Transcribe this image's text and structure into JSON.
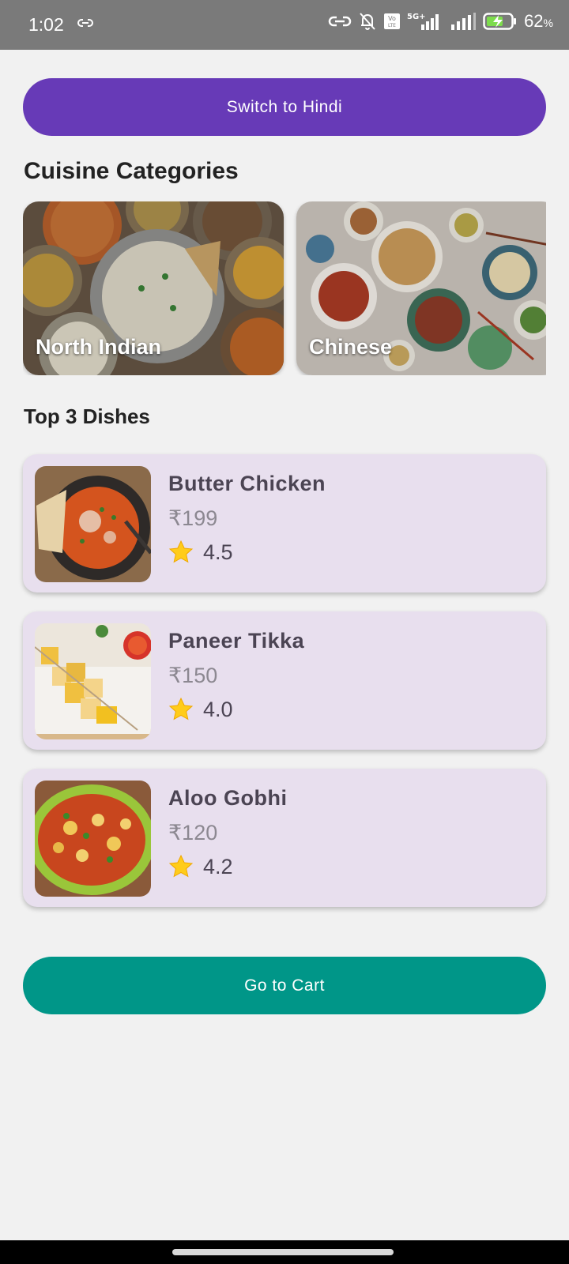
{
  "status_bar": {
    "time": "1:02",
    "battery_percent": "62",
    "battery_unit": "%",
    "icons": [
      "link-icon",
      "hotspot-icon",
      "notifications-off-icon",
      "volte-icon",
      "signal-5g-icon",
      "signal-icon",
      "battery-charging-icon"
    ],
    "network_label": "5G+"
  },
  "language_button": {
    "label": "Switch to Hindi",
    "color": "#673ab7"
  },
  "categories": {
    "title": "Cuisine Categories",
    "items": [
      {
        "label": "North Indian",
        "image": "north-indian-thali-image"
      },
      {
        "label": "Chinese",
        "image": "chinese-dishes-image"
      }
    ]
  },
  "top_dishes": {
    "title": "Top 3 Dishes",
    "items": [
      {
        "name": "Butter Chicken",
        "price": "₹199",
        "rating": "4.5",
        "image": "butter-chicken-image"
      },
      {
        "name": "Paneer Tikka",
        "price": "₹150",
        "rating": "4.0",
        "image": "paneer-tikka-image"
      },
      {
        "name": "Aloo Gobhi",
        "price": "₹120",
        "rating": "4.2",
        "image": "aloo-gobhi-image"
      }
    ]
  },
  "cart_button": {
    "label": "Go to Cart",
    "color": "#009688"
  }
}
